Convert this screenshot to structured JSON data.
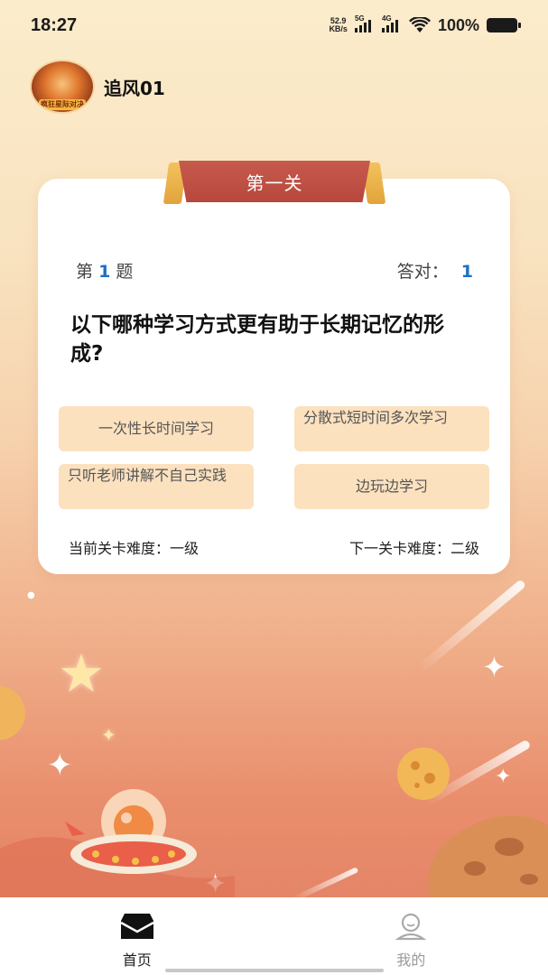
{
  "status_bar": {
    "time": "18:27",
    "net_speed_value": "52.9",
    "net_speed_unit": "KB/s",
    "signal_1": "5G",
    "signal_2": "4G",
    "battery": "100%"
  },
  "profile": {
    "username": "追风01",
    "avatar_text": "疯狂星际对决"
  },
  "quiz": {
    "level_title": "第一关",
    "question_prefix": "第",
    "question_number": "1",
    "question_suffix": "题",
    "correct_label": "答对：",
    "correct_count": "1",
    "question_text": "以下哪种学习方式更有助于长期记忆的形成?",
    "options": [
      {
        "label": "一次性长时间学习"
      },
      {
        "label": "分散式短时间多次学习"
      },
      {
        "label": "只听老师讲解不自己实践"
      },
      {
        "label": "边玩边学习"
      }
    ],
    "current_difficulty": "当前关卡难度：一级",
    "next_difficulty": "下一关卡难度：二级"
  },
  "tabbar": {
    "items": [
      {
        "label": "首页",
        "icon": "home-icon",
        "active": true
      },
      {
        "label": "我的",
        "icon": "profile-icon",
        "active": false
      }
    ]
  },
  "colors": {
    "ribbon": "#b8473d",
    "option_bg": "#fce1bf",
    "accent_number": "#1f6fc4"
  }
}
